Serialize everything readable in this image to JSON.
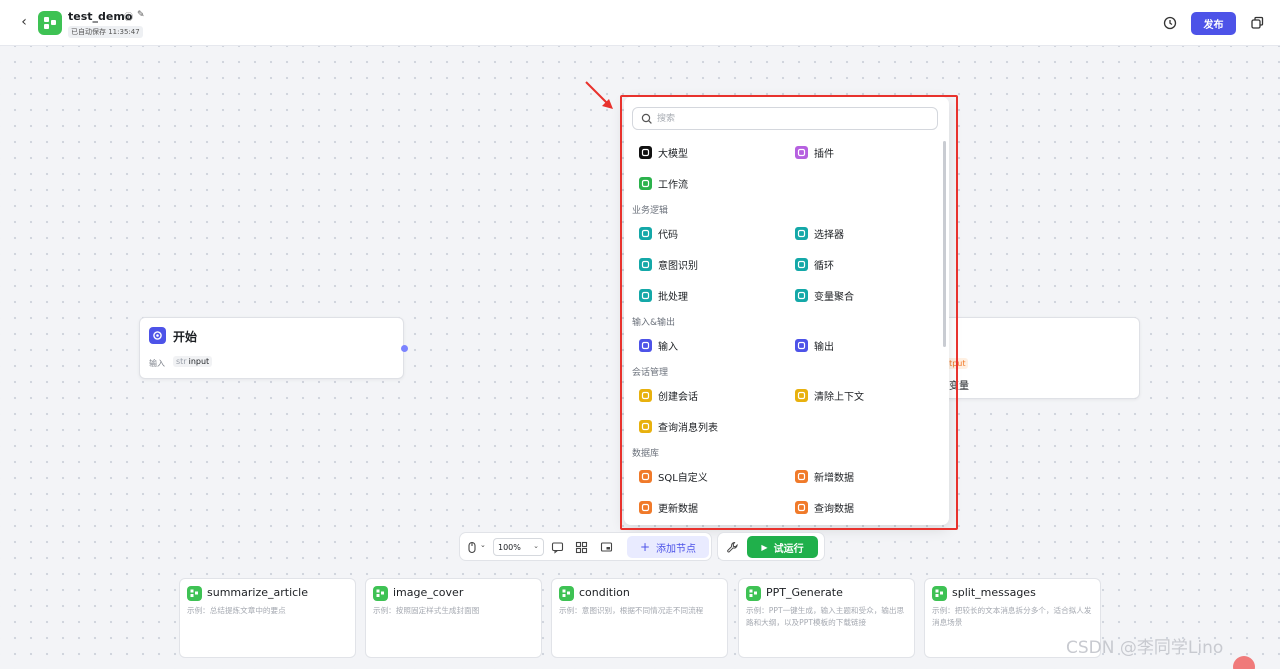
{
  "header": {
    "back_label": "‹",
    "app_name": "test_demo",
    "info_icon": "ⓘ",
    "edit_icon": "✎",
    "save_status": "已自动保存 11:35:47",
    "publish_label": "发布"
  },
  "start_node": {
    "title": "开始",
    "field_label": "输入",
    "param_type": "str",
    "param_name": "input"
  },
  "end_node": {
    "badge": "utput",
    "var_label": "变量"
  },
  "add_menu": {
    "search_placeholder": "搜索",
    "top_items": [
      {
        "label": "大模型",
        "icon": "llm-icon",
        "color": "#111111"
      },
      {
        "label": "插件",
        "icon": "plugin-icon",
        "color": "#b660e0"
      },
      {
        "label": "工作流",
        "icon": "workflow-icon",
        "color": "#2bb24c"
      }
    ],
    "sections": [
      {
        "title": "业务逻辑",
        "items": [
          {
            "label": "代码",
            "icon": "code-icon",
            "color": "#14a8a8"
          },
          {
            "label": "选择器",
            "icon": "if-icon",
            "color": "#14a8a8"
          },
          {
            "label": "意图识别",
            "icon": "intent-icon",
            "color": "#14a8a8"
          },
          {
            "label": "循环",
            "icon": "loop-icon",
            "color": "#14a8a8"
          },
          {
            "label": "批处理",
            "icon": "batch-icon",
            "color": "#14a8a8"
          },
          {
            "label": "变量聚合",
            "icon": "aggregate-icon",
            "color": "#14a8a8"
          }
        ]
      },
      {
        "title": "输入&输出",
        "items": [
          {
            "label": "输入",
            "icon": "input-icon",
            "color": "#4d53e8"
          },
          {
            "label": "输出",
            "icon": "output-icon",
            "color": "#4d53e8"
          }
        ]
      },
      {
        "title": "会话管理",
        "items": [
          {
            "label": "创建会话",
            "icon": "create-conversation-icon",
            "color": "#e8b10e"
          },
          {
            "label": "清除上下文",
            "icon": "clear-context-icon",
            "color": "#e8b10e"
          },
          {
            "label": "查询消息列表",
            "icon": "query-messages-icon",
            "color": "#e8b10e"
          }
        ]
      },
      {
        "title": "数据库",
        "items": [
          {
            "label": "SQL自定义",
            "icon": "sql-icon",
            "color": "#f07a2a"
          },
          {
            "label": "新增数据",
            "icon": "insert-data-icon",
            "color": "#f07a2a"
          },
          {
            "label": "更新数据",
            "icon": "update-data-icon",
            "color": "#f07a2a"
          },
          {
            "label": "查询数据",
            "icon": "query-data-icon",
            "color": "#f07a2a"
          }
        ]
      }
    ]
  },
  "toolbar": {
    "zoom": "100%",
    "add_node_label": "添加节点",
    "run_label": "试运行"
  },
  "templates": [
    {
      "title": "summarize_article",
      "desc": "示例：总结提炼文章中的要点"
    },
    {
      "title": "image_cover",
      "desc": "示例：按照固定样式生成封面图"
    },
    {
      "title": "condition",
      "desc": "示例：意图识别，根据不同情况走不同流程"
    },
    {
      "title": "PPT_Generate",
      "desc": "示例：PPT一键生成，输入主题和受众，输出思路和大纲，以及PPT模板的下载链接"
    },
    {
      "title": "split_messages",
      "desc": "示例：把较长的文本消息拆分多个，适合拟人发消息场景"
    }
  ],
  "watermark": "CSDN @李同学Lino",
  "colors": {
    "brand": "#4d53e8",
    "run": "#20b04b",
    "workflow": "#3ec254",
    "annotation": "#e8322d"
  }
}
